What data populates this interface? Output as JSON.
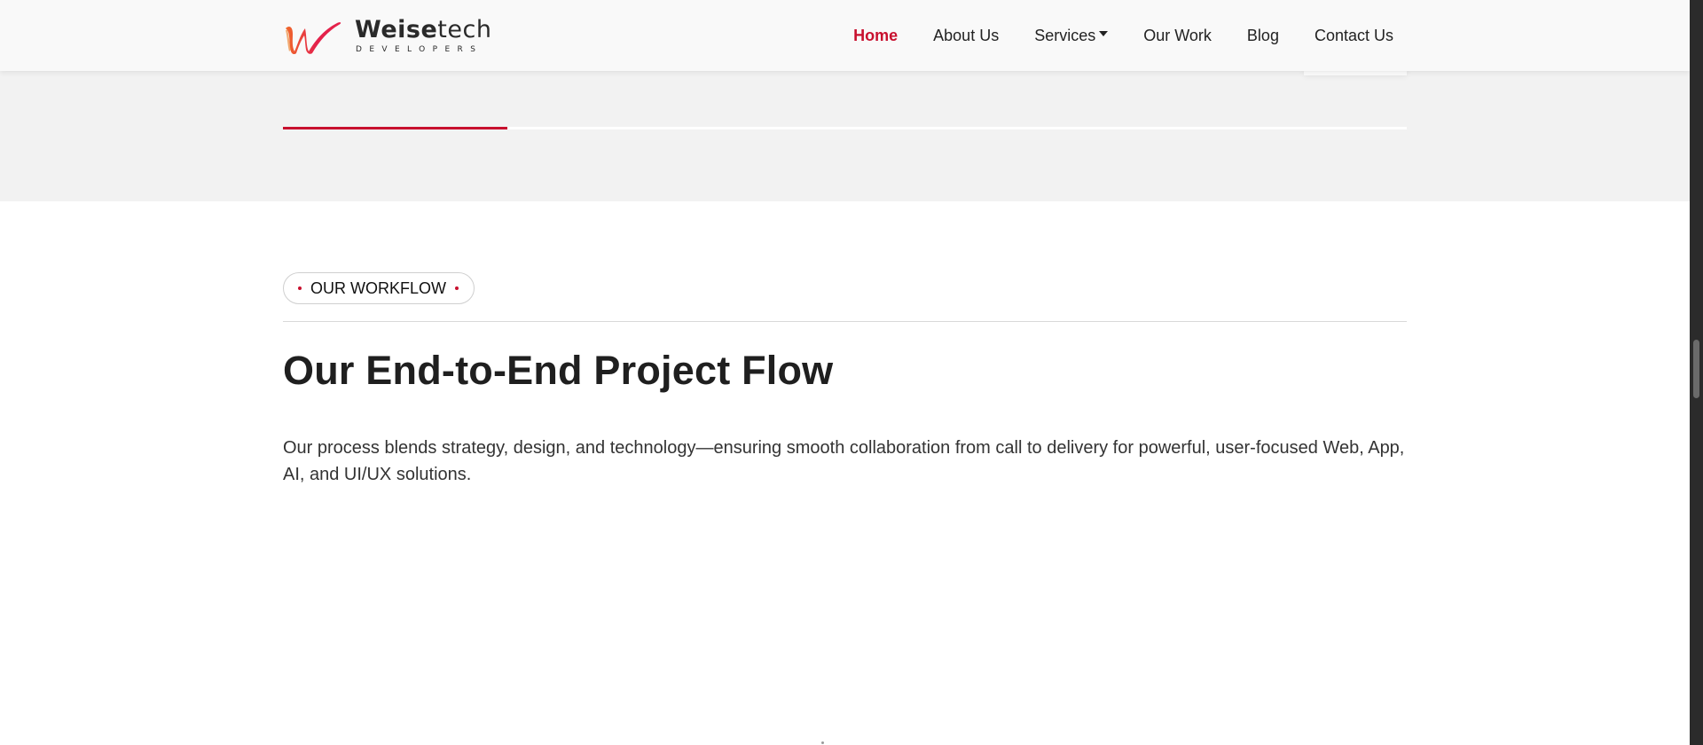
{
  "brand": {
    "name_bold": "Weise",
    "name_light": "tech",
    "tagline": "DEVELOPERS",
    "colors": {
      "accent": "#c8102e",
      "logo_red": "#e4224b",
      "logo_orange": "#f06a2a"
    }
  },
  "nav": {
    "items": [
      {
        "label": "Home",
        "active": true
      },
      {
        "label": "About Us",
        "active": false
      },
      {
        "label": "Services",
        "active": false,
        "has_dropdown": true
      },
      {
        "label": "Our Work",
        "active": false
      },
      {
        "label": "Blog",
        "active": false
      },
      {
        "label": "Contact Us",
        "active": false
      }
    ]
  },
  "progress": {
    "fraction": 0.2
  },
  "workflow": {
    "badge": "OUR WORKFLOW",
    "title": "Our End-to-End Project Flow",
    "description": "Our process blends strategy, design, and technology—ensuring smooth collaboration from call to delivery for powerful, user-focused Web, App, AI, and UI/UX solutions."
  },
  "icons": {
    "logo": "weisetech-w-logo-icon",
    "dropdown": "caret-down-icon"
  }
}
